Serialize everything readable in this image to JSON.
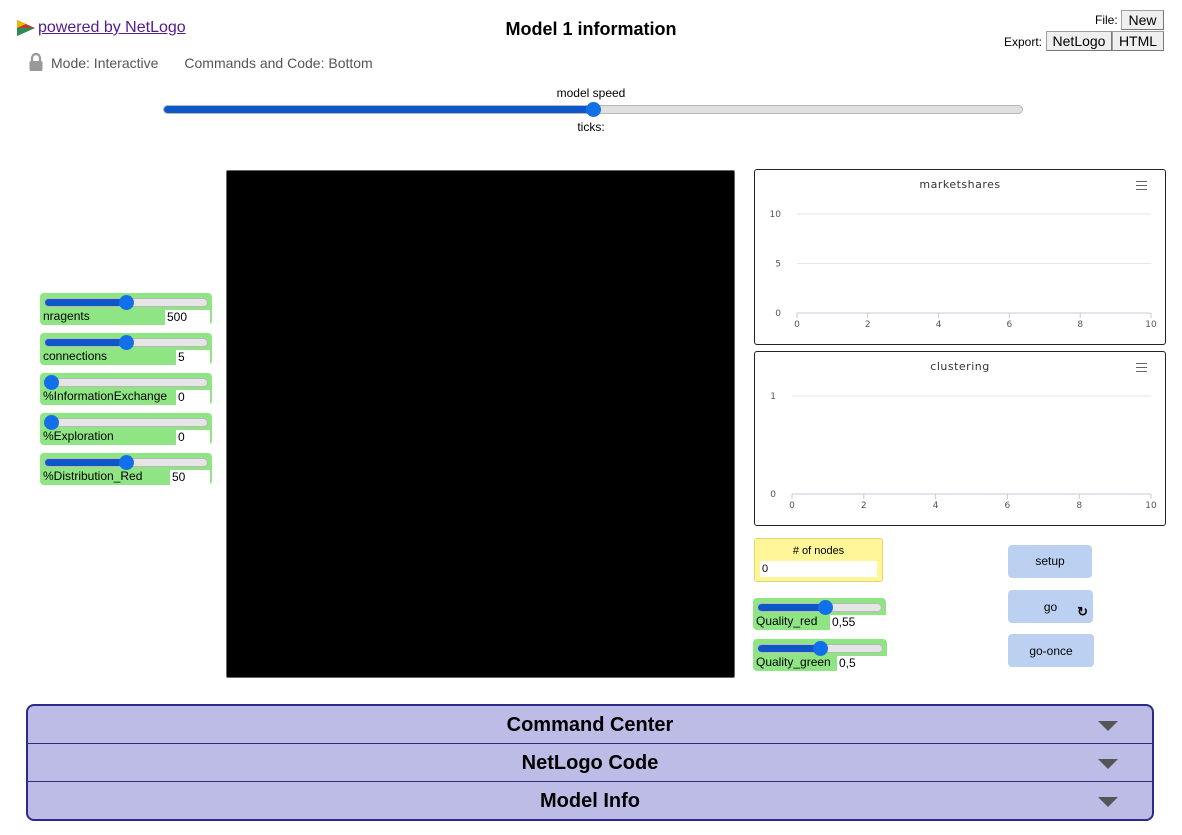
{
  "header": {
    "powered_by": "powered by NetLogo",
    "title": "Model 1 information",
    "mode": "Mode: Interactive",
    "commands_position": "Commands and Code: Bottom",
    "file_label": "File:",
    "new_button": "New",
    "export_label": "Export:",
    "export_netlogo": "NetLogo",
    "export_html": "HTML"
  },
  "speed": {
    "label": "model speed",
    "value": 0.5,
    "ticks_label": "ticks:"
  },
  "sliders": [
    {
      "name": "nragents",
      "value": "500",
      "fraction": 0.5
    },
    {
      "name": "connections",
      "value": "5",
      "fraction": 0.5
    },
    {
      "name": "%InformationExchange",
      "value": "0",
      "fraction": 0.0
    },
    {
      "name": "%Exploration",
      "value": "0",
      "fraction": 0.0
    },
    {
      "name": "%Distribution_Red",
      "value": "50",
      "fraction": 0.5
    }
  ],
  "plots": [
    {
      "title": "marketshares",
      "x_ticks": [
        "0",
        "2",
        "4",
        "6",
        "8",
        "10"
      ],
      "y_ticks": [
        "0",
        "5",
        "10"
      ],
      "xlim": [
        0,
        10
      ],
      "ylim": [
        0,
        10
      ]
    },
    {
      "title": "clustering",
      "x_ticks": [
        "0",
        "2",
        "4",
        "6",
        "8",
        "10"
      ],
      "y_ticks": [
        "0",
        "1"
      ],
      "xlim": [
        0,
        10
      ],
      "ylim": [
        0,
        1
      ]
    }
  ],
  "monitor": {
    "label": "# of nodes",
    "value": "0"
  },
  "small_sliders": [
    {
      "name": "Quality_red",
      "value": "0,55",
      "fraction": 0.55
    },
    {
      "name": "Quality_green",
      "value": "0,5",
      "fraction": 0.5
    }
  ],
  "buttons": {
    "setup": "setup",
    "go": "go",
    "go_once": "go-once"
  },
  "accordion": {
    "command_center": "Command Center",
    "netlogo_code": "NetLogo Code",
    "model_info": "Model Info"
  },
  "colors": {
    "slider_bg": "#8fe584",
    "button_bg": "#bcd1f2",
    "monitor_bg": "#fff69a",
    "accordion_bg": "#bcbce6",
    "slider_fill": "#0d57c9"
  }
}
